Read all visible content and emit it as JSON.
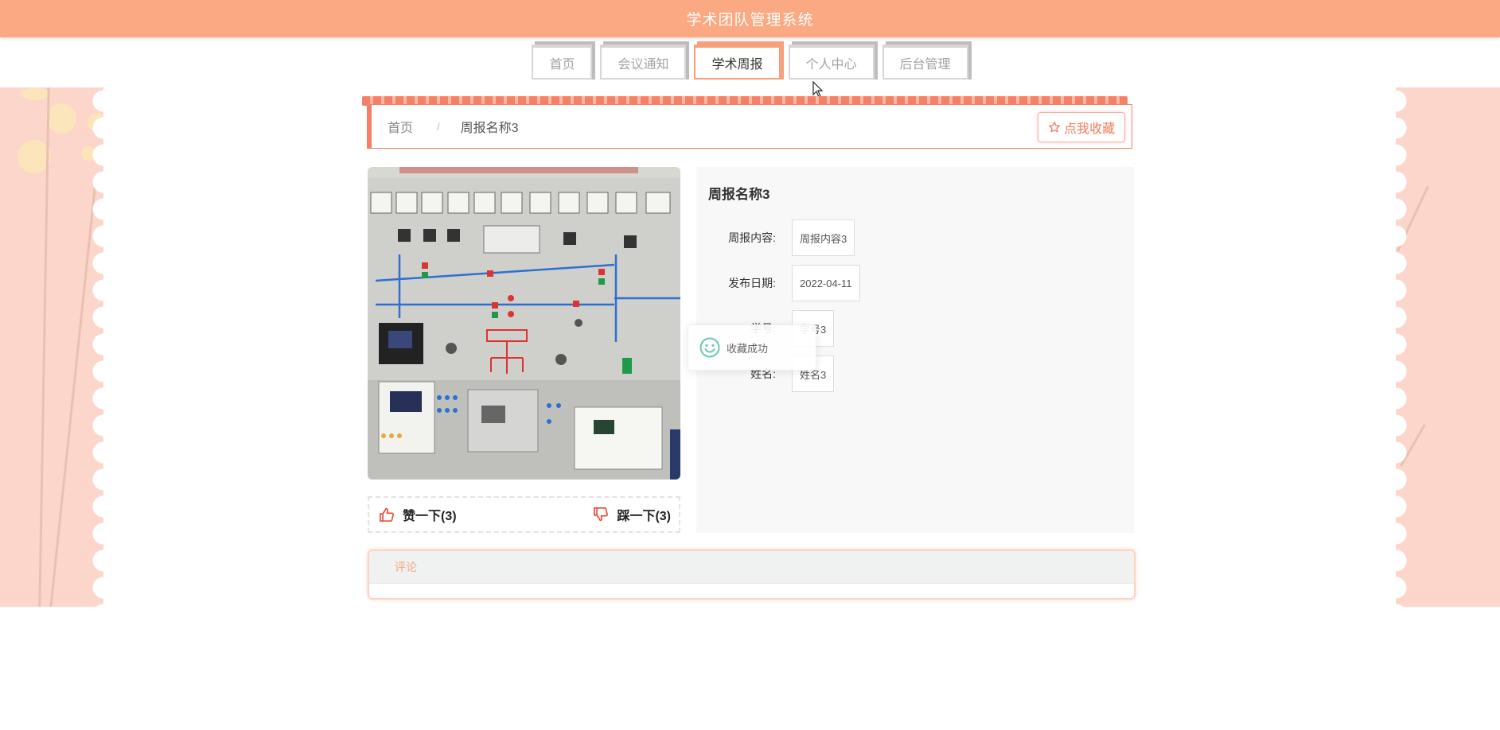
{
  "header": {
    "title": "学术团队管理系统"
  },
  "nav": {
    "items": [
      {
        "label": "首页"
      },
      {
        "label": "会议通知"
      },
      {
        "label": "学术周报"
      },
      {
        "label": "个人中心"
      },
      {
        "label": "后台管理"
      }
    ],
    "active_index": 2
  },
  "breadcrumb": {
    "home": "首页",
    "separator": "/",
    "current": "周报名称3",
    "favorite_button": "点我收藏"
  },
  "votes": {
    "like": "赞一下(3)",
    "dislike": "踩一下(3)"
  },
  "detail": {
    "title": "周报名称3",
    "fields": [
      {
        "label": "周报内容:",
        "value": "周报内容3"
      },
      {
        "label": "发布日期:",
        "value": "2022-04-11"
      },
      {
        "label": "学号:",
        "value": "学号3"
      },
      {
        "label": "姓名:",
        "value": "姓名3"
      }
    ]
  },
  "toast": {
    "message": "收藏成功"
  },
  "comments": {
    "tab": "评论"
  },
  "colors": {
    "header_bg": "#fba982",
    "accent": "#f58066",
    "side_panel": "#fcd6ca",
    "success_icon": "#67c23a"
  }
}
